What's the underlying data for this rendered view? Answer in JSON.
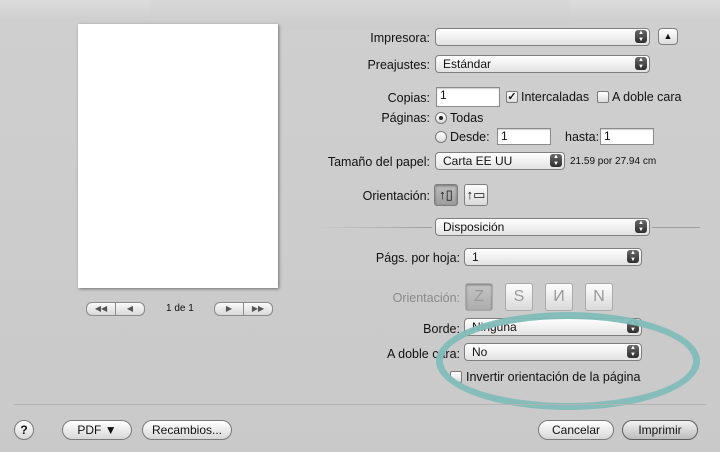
{
  "printer": {
    "label": "Impresora:",
    "value": ""
  },
  "presets": {
    "label": "Preajustes:",
    "value": "Estándar"
  },
  "copies": {
    "label": "Copias:",
    "value": "1",
    "collated_label": "Intercaladas",
    "collated_checked": true,
    "duplex_label": "A doble cara",
    "duplex_checked": false
  },
  "pages": {
    "label": "Páginas:",
    "all_label": "Todas",
    "from_label": "Desde:",
    "from_value": "1",
    "to_label": "hasta:",
    "to_value": "1"
  },
  "paper_size": {
    "label": "Tamaño del papel:",
    "value": "Carta EE UU",
    "dimensions": "21.59 por 27.94 cm"
  },
  "orientation": {
    "label": "Orientación:"
  },
  "section": {
    "value": "Disposición"
  },
  "layout": {
    "pages_per_sheet_label": "Págs. por hoja:",
    "pages_per_sheet_value": "1",
    "direction_label": "Orientación:",
    "border_label": "Borde:",
    "border_value": "Ninguna",
    "two_sided_label": "A doble cara:",
    "two_sided_value": "No",
    "reverse_label": "Invertir orientación de la página"
  },
  "preview": {
    "page_count": "1 de 1",
    "nav_first": "◀◀",
    "nav_prev": "◀",
    "nav_next": "▶",
    "nav_last": "▶▶"
  },
  "footer": {
    "help": "?",
    "pdf": "PDF ▼",
    "supplies": "Recambios...",
    "cancel": "Cancelar",
    "print": "Imprimir"
  },
  "colors": {
    "annotation_ellipse": "#7fbcb8"
  },
  "icons": {
    "collapse": "triangle-up-icon",
    "popup_arrows": "up-down-arrows-icon",
    "portrait": "portrait-orientation-icon",
    "landscape": "landscape-orientation-icon"
  }
}
